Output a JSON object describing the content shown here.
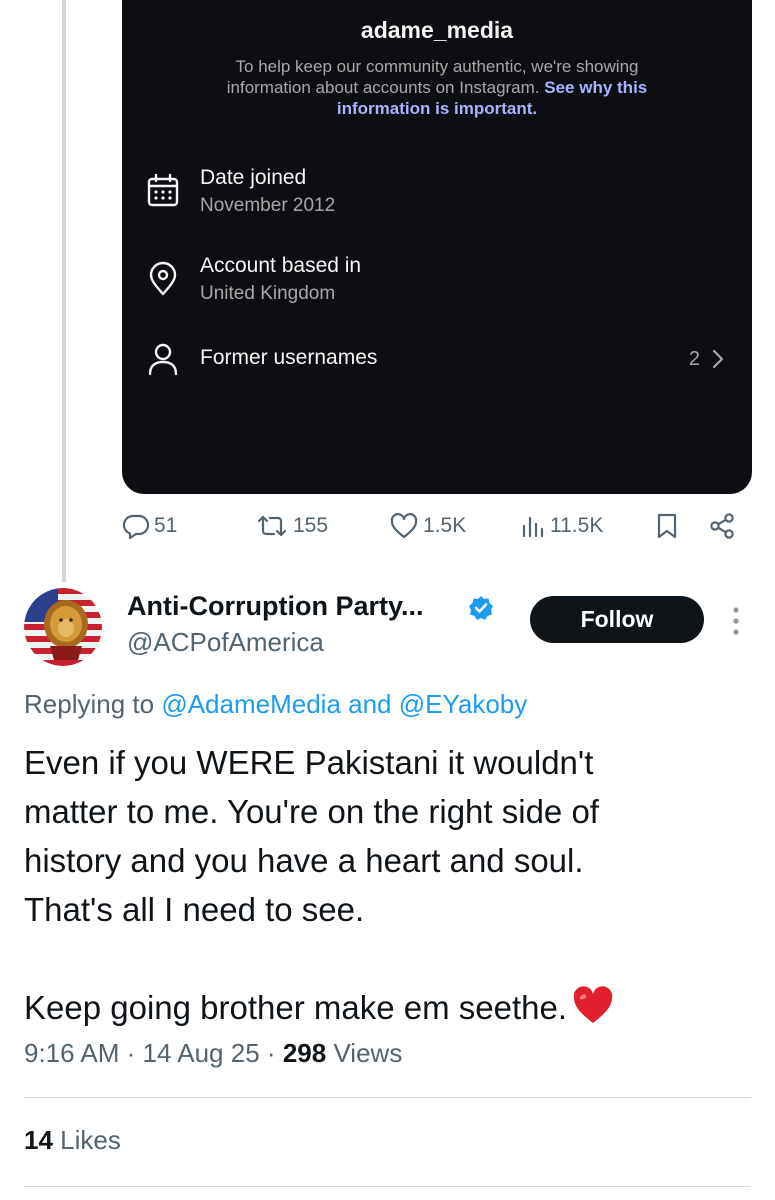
{
  "instagram_card": {
    "username": "adame_media",
    "notice_text": "To help keep our community authentic, we're showing information about accounts on Instagram.",
    "notice_link": "See why this information is important.",
    "rows": [
      {
        "icon": "calendar-icon",
        "title": "Date joined",
        "value": "November 2012"
      },
      {
        "icon": "location-pin-icon",
        "title": "Account based in",
        "value": "United Kingdom"
      },
      {
        "icon": "person-icon",
        "title": "Former usernames",
        "count": "2"
      }
    ]
  },
  "parent_tweet_actions": {
    "replies": "51",
    "reposts": "155",
    "likes": "1.5K",
    "views": "11.5K"
  },
  "reply_tweet": {
    "display_name": "Anti-Corruption Party...",
    "handle": "@ACPofAmerica",
    "follow_label": "Follow",
    "replying_prefix": "Replying to",
    "replying_to": "@AdameMedia and @EYakoby",
    "text_lines": [
      "Even if you WERE Pakistani it wouldn't",
      "matter to me. You're on the right side of",
      "history and you have a heart and soul.",
      "That's all I need to see.",
      "Keep going brother make em seethe."
    ],
    "time": "9:16 AM",
    "date": "14 Aug 25",
    "views_count": "298",
    "views_label": "Views",
    "likes_count": "14",
    "likes_label": "Likes"
  },
  "colors": {
    "accent": "#1d9bf0",
    "secondary_text": "#536471",
    "card_bg": "#0c0e12",
    "ig_link": "#a7b4ff",
    "heart": "#e0202e"
  }
}
